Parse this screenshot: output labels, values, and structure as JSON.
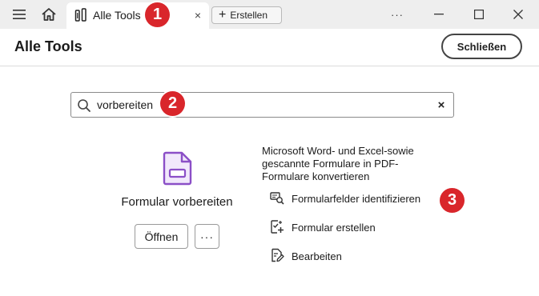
{
  "titlebar": {
    "tab_label": "Alle Tools",
    "tab_close_glyph": "×",
    "create_label": "Erstellen",
    "more_glyph": "···",
    "icons": [
      "menu-icon",
      "home-icon",
      "tools-icon",
      "minimize-icon",
      "maximize-icon",
      "window-close-icon"
    ]
  },
  "header": {
    "title": "Alle Tools",
    "close_label": "Schließen"
  },
  "search": {
    "value": "vorbereiten",
    "clear_glyph": "×"
  },
  "tool": {
    "name": "Formular vorbereiten",
    "open_label": "Öffnen",
    "more_glyph": "···",
    "description": "Microsoft Word- und Excel-sowie gescannte Formulare in PDF-Formulare konvertieren",
    "features": [
      {
        "label": "Formularfelder identifizieren",
        "icon": "identify-fields-icon"
      },
      {
        "label": "Formular erstellen",
        "icon": "create-form-icon"
      },
      {
        "label": "Bearbeiten",
        "icon": "edit-icon"
      }
    ]
  },
  "annotations": {
    "badge_1": "1",
    "badge_2": "2",
    "badge_3": "3",
    "badge_color": "#d9262b"
  },
  "colors": {
    "accent_purple": "#8b4fc7",
    "titlebar_bg": "#eeeeee"
  }
}
